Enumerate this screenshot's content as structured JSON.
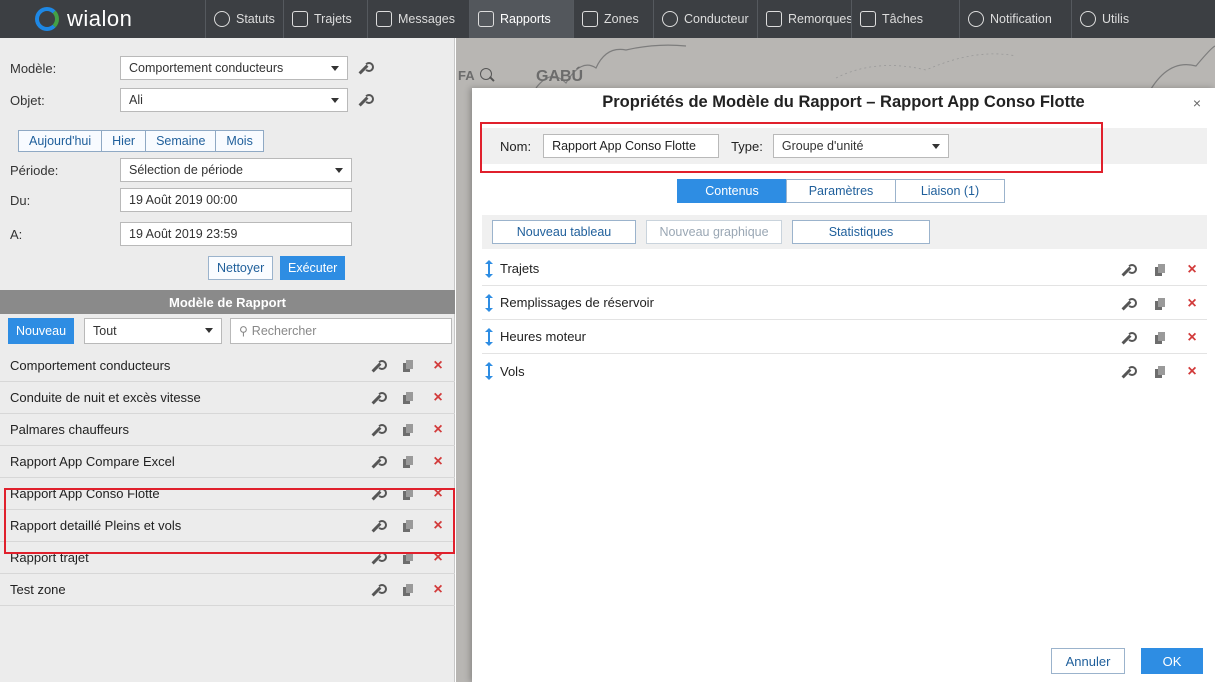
{
  "nav": {
    "logo": "wialon",
    "items": [
      {
        "label": "Statuts",
        "icon": "globe-icon"
      },
      {
        "label": "Trajets",
        "icon": "flag-icon"
      },
      {
        "label": "Messages",
        "icon": "list-icon"
      },
      {
        "label": "Rapports",
        "icon": "report-icon"
      },
      {
        "label": "Zones",
        "icon": "zone-icon"
      },
      {
        "label": "Conducteur",
        "icon": "steering-wheel-icon"
      },
      {
        "label": "Remorques",
        "icon": "trailer-icon"
      },
      {
        "label": "Tâches",
        "icon": "task-icon"
      },
      {
        "label": "Notification",
        "icon": "clock-icon"
      },
      {
        "label": "Utilis",
        "icon": "user-icon"
      }
    ],
    "active": "Rapports"
  },
  "left": {
    "modele_label": "Modèle:",
    "modele_value": "Comportement conducteurs",
    "objet_label": "Objet:",
    "objet_value": "Ali",
    "date_buttons": [
      "Aujourd'hui",
      "Hier",
      "Semaine",
      "Mois"
    ],
    "periode_label": "Période:",
    "periode_value": "Sélection de période",
    "du_label": "Du:",
    "du_value": "19 Août 2019 00:00",
    "a_label": "A:",
    "a_value": "19 Août 2019 23:59",
    "nettoyer": "Nettoyer",
    "executer": "Exécuter",
    "section_title": "Modèle de Rapport",
    "nouveau": "Nouveau",
    "filter_value": "Tout",
    "search_placeholder": "Rechercher",
    "templates": [
      "Comportement conducteurs",
      "Conduite de nuit et excès vitesse",
      "Palmares chauffeurs",
      "Rapport App Compare Excel",
      "Rapport App Conso Flotte",
      "Rapport detaillé Pleins et vols",
      "Rapport trajet",
      "Test zone"
    ]
  },
  "map": {
    "prefix": "FA",
    "region": "GABÚ"
  },
  "dialog": {
    "title": "Propriétés de Modèle du Rapport – Rapport App Conso Flotte",
    "close": "×",
    "nom_label": "Nom:",
    "nom_value": "Rapport App Conso Flotte",
    "type_label": "Type:",
    "type_value": "Groupe d'unité",
    "tabs": [
      "Contenus",
      "Paramètres",
      "Liaison (1)"
    ],
    "active_tab": "Contenus",
    "toolbar": {
      "new_table": "Nouveau tableau",
      "new_chart": "Nouveau graphique",
      "stats": "Statistiques"
    },
    "tables": [
      "Trajets",
      "Remplissages de réservoir",
      "Heures moteur",
      "Vols"
    ],
    "cancel": "Annuler",
    "ok": "OK"
  },
  "colors": {
    "accent": "#2e8de3",
    "highlight": "#e0202c",
    "nav_bg": "#3c3f43",
    "delete": "#d23b3b"
  }
}
